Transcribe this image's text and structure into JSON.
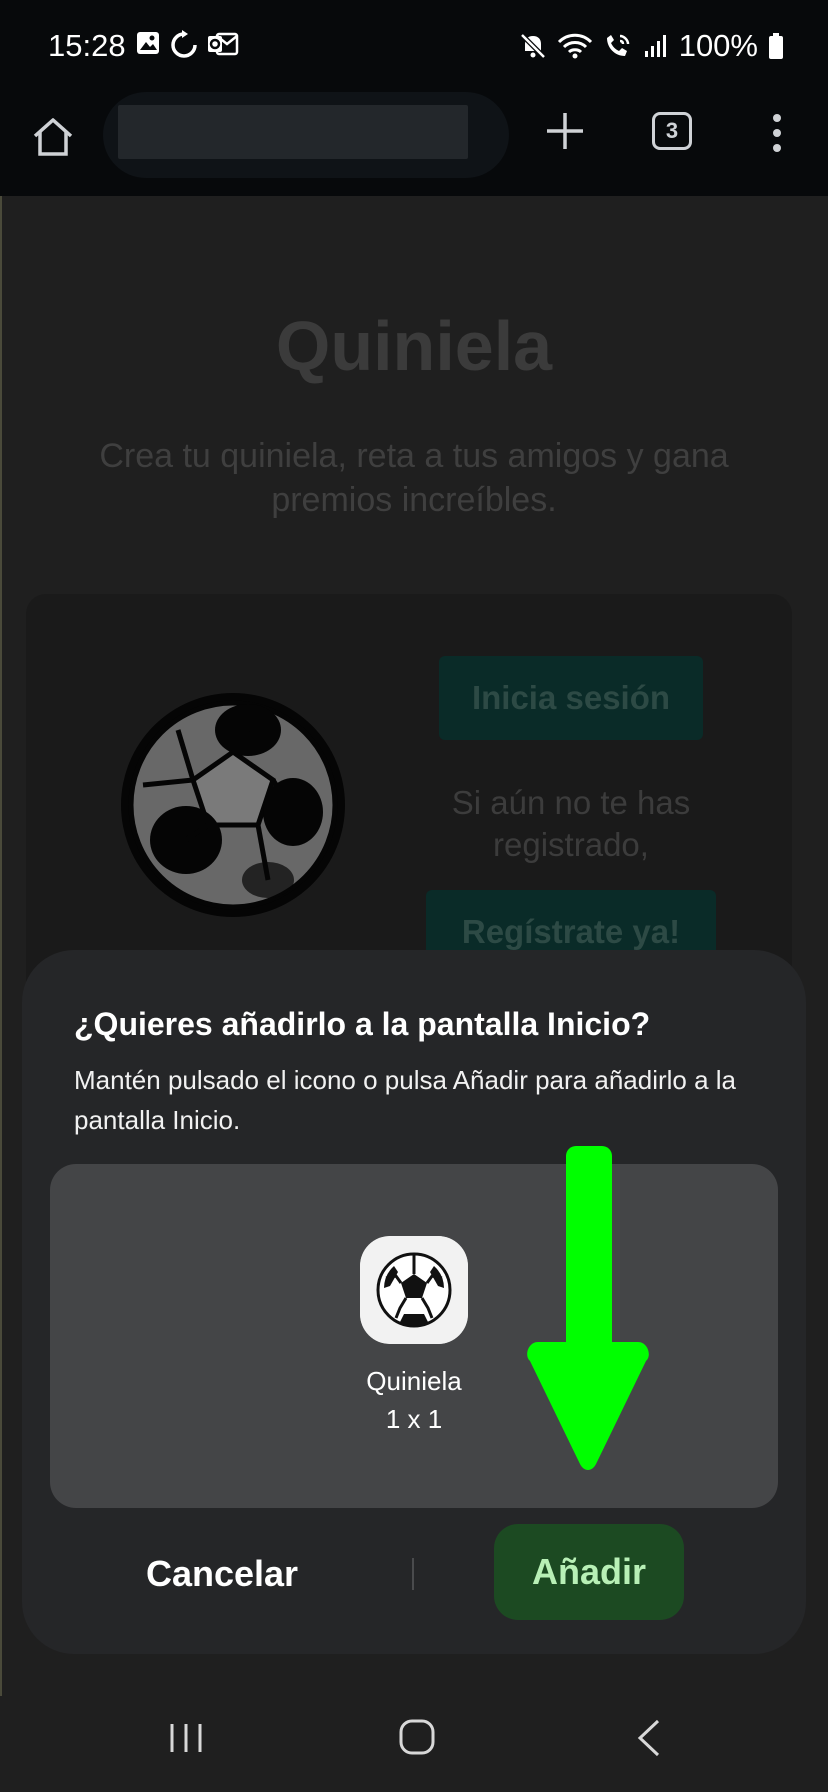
{
  "status_bar": {
    "time": "15:28",
    "battery": "100%",
    "left_icons": [
      "image-icon",
      "sync-icon",
      "outlook-icon"
    ],
    "right_icons": [
      "mute-icon",
      "wifi-icon",
      "wifi-calling-icon",
      "signal-icon",
      "battery-icon"
    ]
  },
  "browser": {
    "tab_count": "3",
    "icons": [
      "home-icon",
      "plus-icon",
      "tabs-icon",
      "more-vert-icon"
    ]
  },
  "page": {
    "title": "Quiniela",
    "subtitle": "Crea tu quiniela, reta a tus amigos y gana premios increíbles.",
    "login_button": "Inicia sesión",
    "not_registered_text": "Si aún no te has registrado,",
    "register_button": "Regístrate ya!"
  },
  "dialog": {
    "title": "¿Quieres añadirlo a la pantalla Inicio?",
    "body": "Mantén pulsado el icono o pulsa Añadir para añadirlo a la pantalla Inicio.",
    "app_name": "Quiniela",
    "widget_size": "1 x 1",
    "cancel_label": "Cancelar",
    "add_label": "Añadir"
  },
  "colors": {
    "annotation_arrow": "#00ff00",
    "add_button_bg": "#1c4a22",
    "add_button_text": "#b8f0b6"
  },
  "nav_bar": {
    "icons": [
      "recents-icon",
      "home-icon",
      "back-icon"
    ]
  }
}
